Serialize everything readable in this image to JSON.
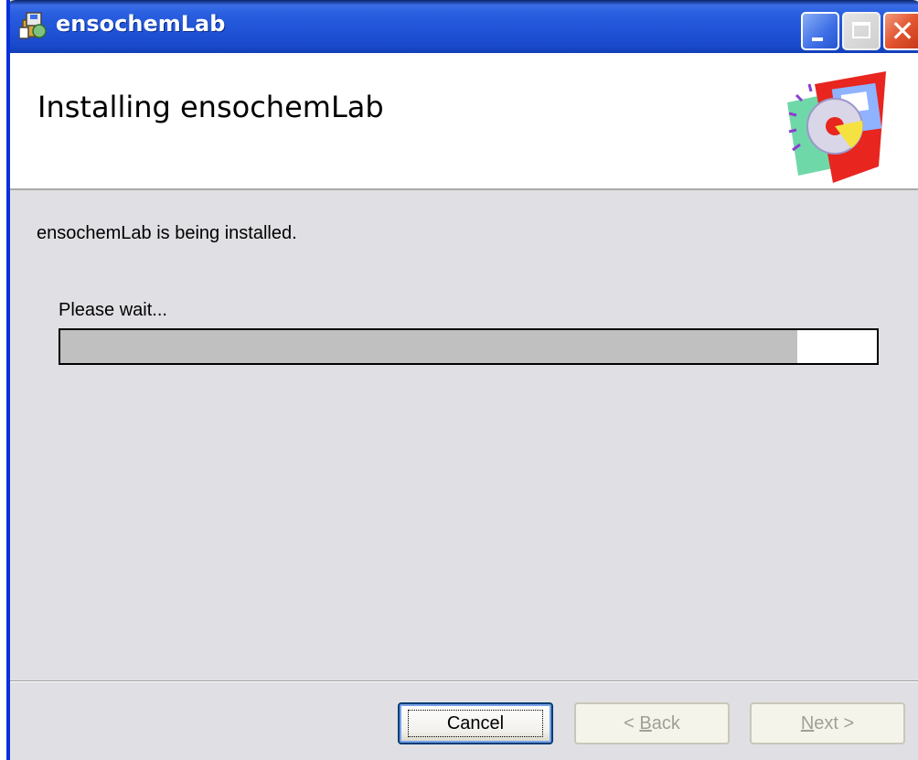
{
  "window": {
    "title": "ensochemLab"
  },
  "banner": {
    "title": "Installing ensochemLab"
  },
  "content": {
    "status": "ensochemLab is being installed.",
    "wait_label": "Please wait...",
    "progress_fraction": 0.903
  },
  "buttons": {
    "cancel": "Cancel",
    "back_prefix": "< ",
    "back_mnemonic": "B",
    "back_rest": "ack",
    "next_mnemonic": "N",
    "next_rest": "ext >"
  },
  "colors": {
    "titlebar": "#1f52d6",
    "progress_fill": "#c0c0c0",
    "dialog_bg": "#e0dfe3"
  },
  "icons": {
    "title_icon": "installer-package-icon",
    "banner_graphic": "setup-cd-floppy-graphic",
    "minimize": "minimize-icon",
    "maximize": "maximize-icon",
    "close": "close-icon"
  }
}
